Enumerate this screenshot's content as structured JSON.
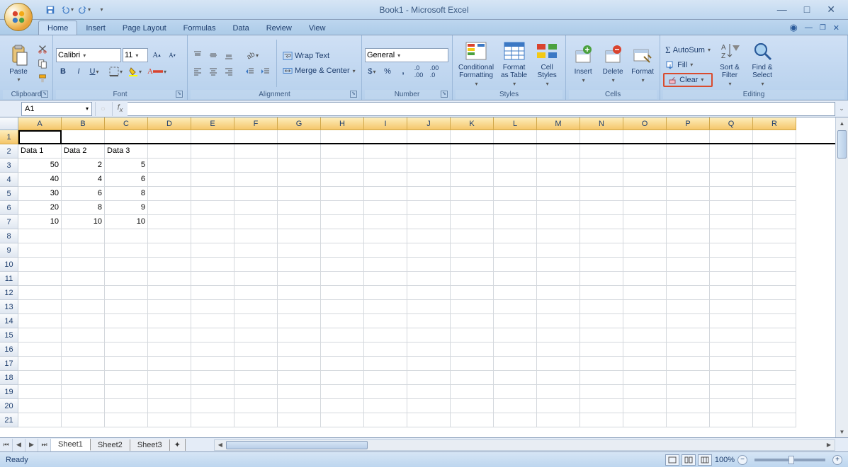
{
  "title": "Book1 - Microsoft Excel",
  "tabs": [
    "Home",
    "Insert",
    "Page Layout",
    "Formulas",
    "Data",
    "Review",
    "View"
  ],
  "activeTab": "Home",
  "ribbon": {
    "clipboard": {
      "paste": "Paste",
      "label": "Clipboard"
    },
    "font": {
      "name": "Calibri",
      "size": "11",
      "label": "Font"
    },
    "alignment": {
      "wrap": "Wrap Text",
      "merge": "Merge & Center",
      "label": "Alignment"
    },
    "number": {
      "format": "General",
      "label": "Number"
    },
    "styles": {
      "cond": "Conditional\nFormatting",
      "table": "Format\nas Table",
      "cell": "Cell\nStyles",
      "label": "Styles"
    },
    "cells": {
      "insert": "Insert",
      "delete": "Delete",
      "format": "Format",
      "label": "Cells"
    },
    "editing": {
      "autosum": "AutoSum",
      "fill": "Fill",
      "clear": "Clear",
      "sort": "Sort &\nFilter",
      "find": "Find &\nSelect",
      "label": "Editing"
    }
  },
  "nameBox": "A1",
  "columns": [
    "A",
    "B",
    "C",
    "D",
    "E",
    "F",
    "G",
    "H",
    "I",
    "J",
    "K",
    "L",
    "M",
    "N",
    "O",
    "P",
    "Q",
    "R"
  ],
  "sheetData": {
    "headers": [
      "Data 1",
      "Data 2",
      "Data 3"
    ],
    "rows": [
      [
        50,
        2,
        5
      ],
      [
        40,
        4,
        6
      ],
      [
        30,
        6,
        8
      ],
      [
        20,
        8,
        9
      ],
      [
        10,
        10,
        10
      ]
    ]
  },
  "chart_data": {
    "type": "table",
    "columns": [
      "Data 1",
      "Data 2",
      "Data 3"
    ],
    "rows": [
      [
        50,
        2,
        5
      ],
      [
        40,
        4,
        6
      ],
      [
        30,
        6,
        8
      ],
      [
        20,
        8,
        9
      ],
      [
        10,
        10,
        10
      ]
    ]
  },
  "sheets": [
    "Sheet1",
    "Sheet2",
    "Sheet3"
  ],
  "activeSheet": "Sheet1",
  "status": "Ready",
  "zoom": "100%"
}
